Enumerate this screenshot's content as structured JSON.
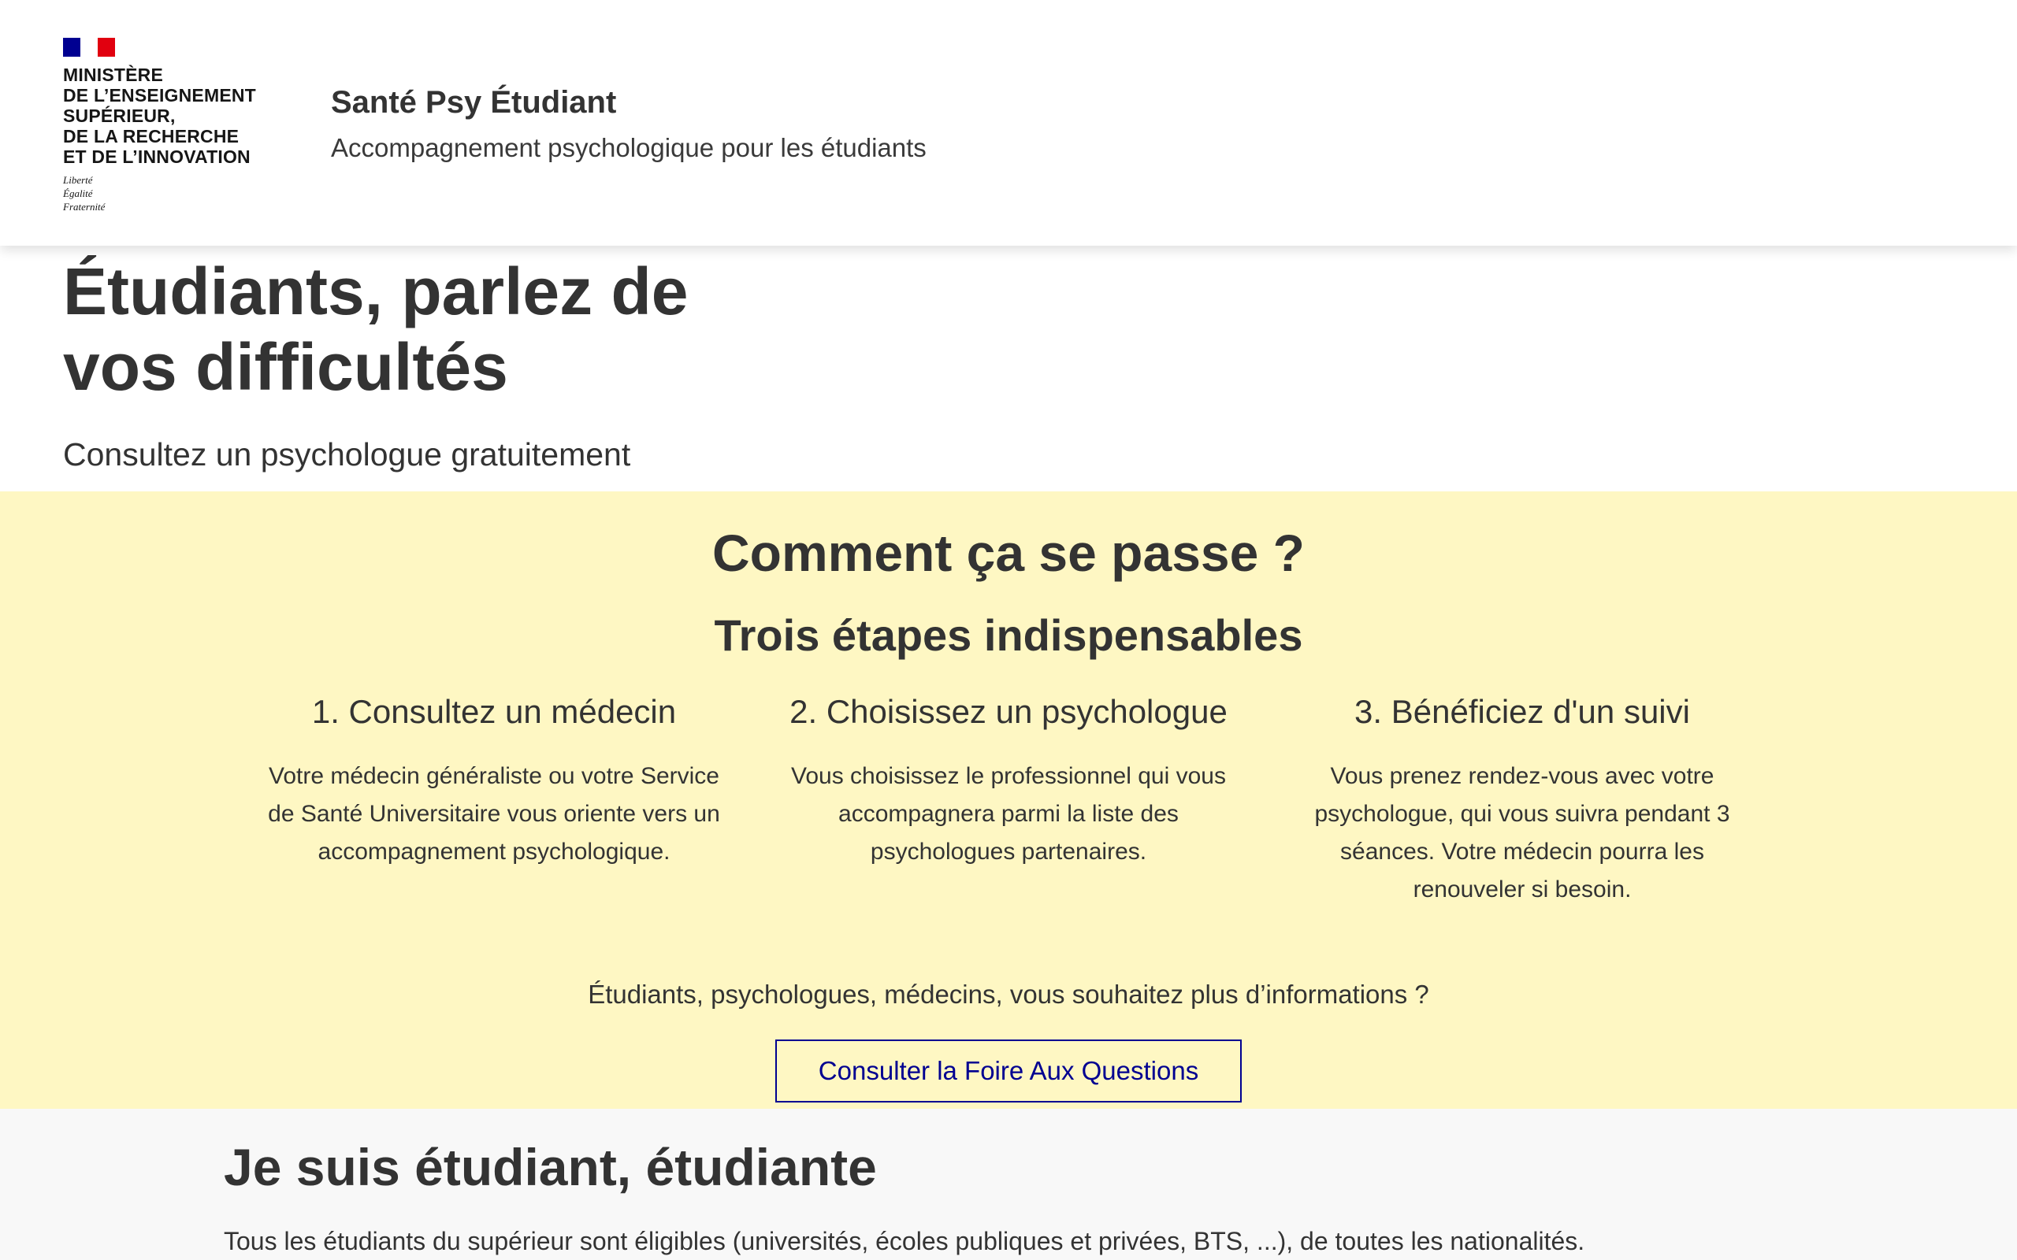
{
  "header": {
    "ministry": "MINISTÈRE\nDE L’ENSEIGNEMENT\nSUPÉRIEUR,\nDE LA RECHERCHE\nET DE L’INNOVATION",
    "devise": "Liberté\nÉgalité\nFraternité",
    "service_title": "Santé Psy Étudiant",
    "service_tagline": "Accompagnement psychologique pour les étudiants"
  },
  "hero": {
    "title_line1": "Étudiants, parlez de",
    "title_line2": "vos difficultés",
    "subtitle": "Consultez un psychologue gratuitement"
  },
  "steps_section": {
    "title": "Comment ça se passe ?",
    "subtitle": "Trois étapes indispensables",
    "steps": [
      {
        "title": "1. Consultez un médecin",
        "text": "Votre médecin généraliste ou votre Service de Santé Universitaire vous oriente vers un accompagnement psychologique."
      },
      {
        "title": "2. Choisissez un psychologue",
        "text": "Vous choisissez le professionnel qui vous accompagnera parmi la liste des psychologues partenaires."
      },
      {
        "title": "3. Bénéficiez d'un suivi",
        "text": "Vous prenez rendez-vous avec votre psychologue, qui vous suivra pendant 3 séances. Votre médecin pourra les renouveler si besoin."
      }
    ],
    "more_info": "Étudiants, psychologues, médecins, vous souhaitez plus d’informations ?",
    "faq_button": "Consulter la Foire Aux Questions"
  },
  "student_section": {
    "title": "Je suis étudiant, étudiante",
    "text": "Tous les étudiants du supérieur sont éligibles (universités, écoles publiques et privées, BTS, ...), de toutes les nationalités."
  },
  "colors": {
    "accent_blue": "#000091",
    "flag_red": "#e1000f",
    "section_yellow": "#fef7c3",
    "section_grey": "#f8f8f8",
    "text": "#333333"
  }
}
